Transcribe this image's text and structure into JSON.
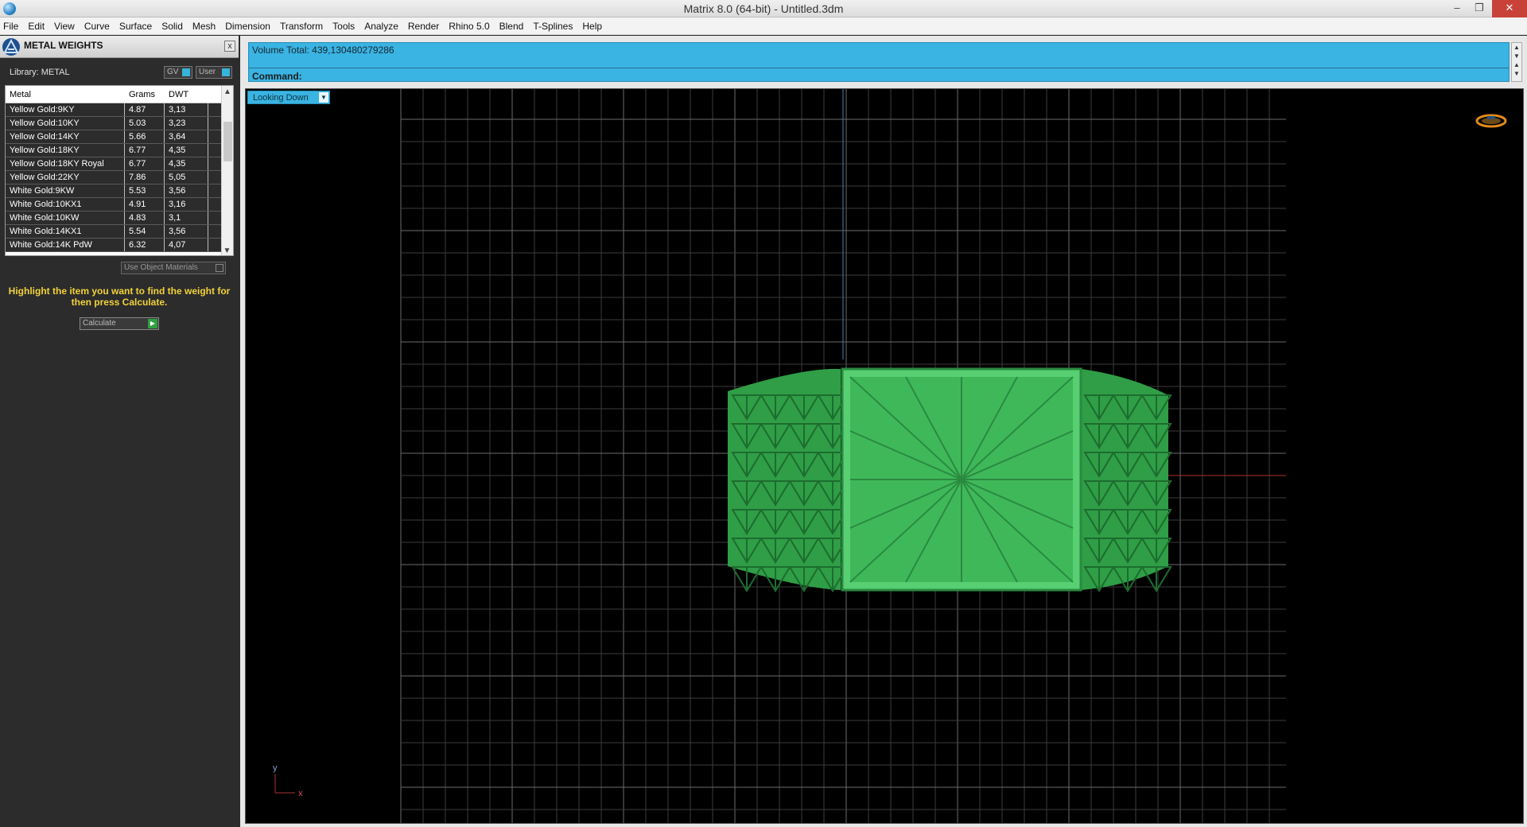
{
  "window": {
    "title": "Matrix 8.0 (64-bit) - Untitled.3dm",
    "minimize": "–",
    "restore": "❐",
    "close": "✕"
  },
  "menu": [
    "File",
    "Edit",
    "View",
    "Curve",
    "Surface",
    "Solid",
    "Mesh",
    "Dimension",
    "Transform",
    "Tools",
    "Analyze",
    "Render",
    "Rhino 5.0",
    "Blend",
    "T-Splines",
    "Help"
  ],
  "panel": {
    "title": "METAL WEIGHTS",
    "close_label": "x",
    "library_label": "Library: METAL",
    "gv_label": "GV",
    "user_label": "User",
    "columns": [
      "Metal",
      "Grams",
      "DWT"
    ],
    "rows": [
      [
        "Yellow Gold:9KY",
        "4.87",
        "3,13"
      ],
      [
        "Yellow Gold:10KY",
        "5.03",
        "3,23"
      ],
      [
        "Yellow Gold:14KY",
        "5.66",
        "3,64"
      ],
      [
        "Yellow Gold:18KY",
        "6.77",
        "4,35"
      ],
      [
        "Yellow Gold:18KY Royal",
        "6.77",
        "4,35"
      ],
      [
        "Yellow Gold:22KY",
        "7.86",
        "5,05"
      ],
      [
        "White Gold:9KW",
        "5.53",
        "3,56"
      ],
      [
        "White Gold:10KX1",
        "4.91",
        "3,16"
      ],
      [
        "White Gold:10KW",
        "4.83",
        "3,1"
      ],
      [
        "White Gold:14KX1",
        "5.54",
        "3,56"
      ],
      [
        "White Gold:14K PdW",
        "6.32",
        "4,07"
      ]
    ],
    "use_object_materials": "Use Object Materials",
    "hint": "Highlight the item you want to find the weight for then press Calculate.",
    "calculate_label": "Calculate"
  },
  "command": {
    "volume_text": "Volume Total: 439,130480279286",
    "command_label": "Command:"
  },
  "viewport": {
    "view_name": "Looking Down",
    "axis_y": "y",
    "axis_x": "x"
  },
  "colors": {
    "accent": "#39b4e3",
    "hint_text": "#f2d23a",
    "model_green": "#3fb85a",
    "grid": "#4a4a4a"
  }
}
